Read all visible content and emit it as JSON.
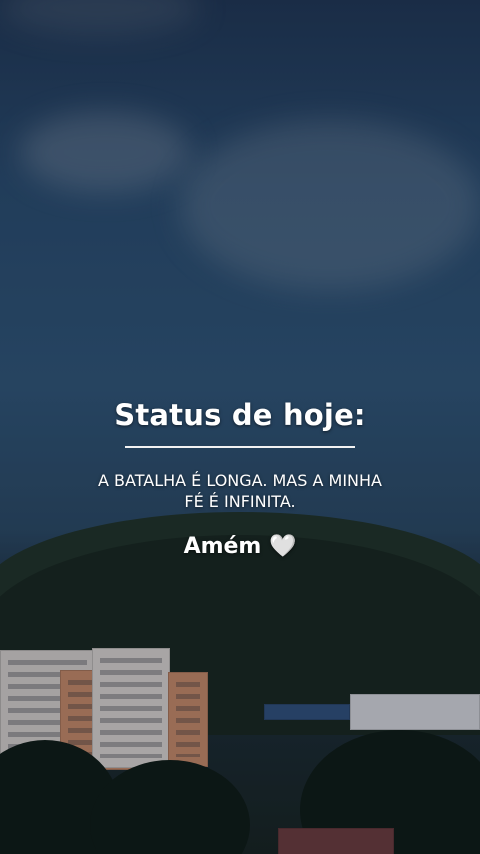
{
  "status": {
    "title": "Status de hoje:",
    "quote": "A BATALHA É LONGA. MAS A MINHA FÉ É INFINITA.",
    "closing": "Amém 🤍"
  },
  "background": {
    "scene": "sky-over-hills-and-buildings"
  }
}
